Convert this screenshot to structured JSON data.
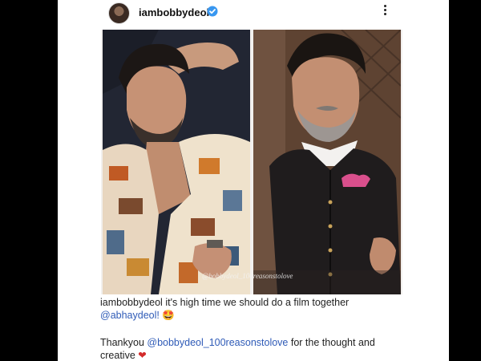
{
  "post": {
    "username": "iambobbydeol",
    "watermark": "@bobbydeol_100reasonstolove"
  },
  "caption": {
    "user": "iambobbydeol",
    "text1": " it's high time we should do a film together",
    "mention1": "@abhaydeol!",
    "emoji1": " 🤩",
    "text2": "Thankyou ",
    "mention2": "@bobbydeol_100reasonstolove",
    "text3": " for the thought and",
    "text4": "creative ",
    "heart": "❤"
  },
  "colors": {
    "background": "#000000",
    "card": "#ffffff",
    "mention": "#2f5bb7",
    "verified": "#3897f0",
    "heart": "#d32b2b"
  },
  "icons": [
    "verified-badge-icon",
    "more-options-icon",
    "heart-emoji-icon"
  ]
}
